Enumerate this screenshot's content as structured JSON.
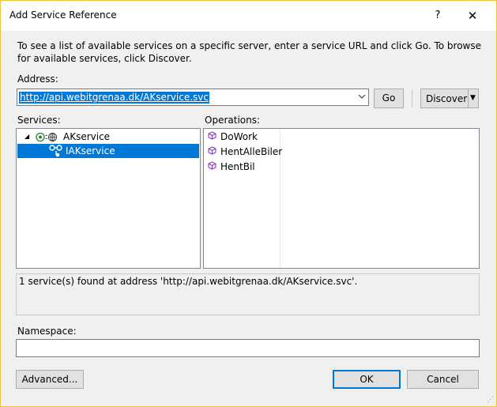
{
  "window": {
    "title": "Add Service Reference",
    "help_glyph": "?",
    "close_glyph": "✕"
  },
  "instructions": "To see a list of available services on a specific server, enter a service URL and click Go. To browse for available services, click Discover.",
  "address": {
    "label": "Address:",
    "value": "http://api.webitgrenaa.dk/AKservice.svc",
    "go_label": "Go",
    "discover_label": "Discover"
  },
  "services": {
    "label": "Services:",
    "tree": [
      {
        "label": "AKservice",
        "expanded": true,
        "icon": "web-service-icon"
      },
      {
        "label": "IAKservice",
        "selected": true,
        "icon": "interface-icon"
      }
    ]
  },
  "operations": {
    "label": "Operations:",
    "items": [
      "DoWork",
      "HentAlleBiler",
      "HentBil"
    ],
    "icon": "method-cube-icon",
    "icon_color": "#8a3fb8"
  },
  "status": "1 service(s) found at address 'http://api.webitgrenaa.dk/AKservice.svc'.",
  "namespace": {
    "label": "Namespace:",
    "value": ""
  },
  "buttons": {
    "advanced": "Advanced...",
    "ok": "OK",
    "cancel": "Cancel"
  },
  "colors": {
    "selection": "#0078d7",
    "dialog_bg": "#f0f0f0",
    "window_border": "#f0c43a"
  }
}
